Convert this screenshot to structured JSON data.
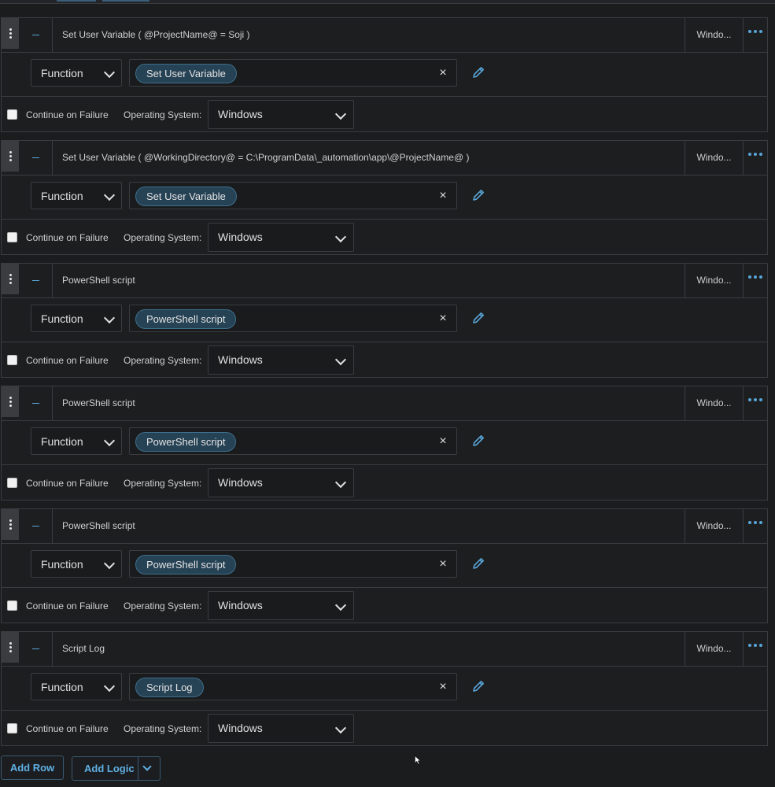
{
  "labels": {
    "function": "Function",
    "continue_on_failure": "Continue on Failure",
    "operating_system": "Operating System:",
    "clear_glyph": "×"
  },
  "steps": [
    {
      "title": "Set User Variable ( @ProjectName@ = Soji )",
      "os_short": "Windo...",
      "function_chip": "Set User Variable",
      "os_value": "Windows"
    },
    {
      "title": "Set User Variable ( @WorkingDirectory@ = C:\\ProgramData\\_automation\\app\\@ProjectName@ )",
      "os_short": "Windo...",
      "function_chip": "Set User Variable",
      "os_value": "Windows"
    },
    {
      "title": "PowerShell script",
      "os_short": "Windo...",
      "function_chip": "PowerShell script",
      "os_value": "Windows"
    },
    {
      "title": "PowerShell script",
      "os_short": "Windo...",
      "function_chip": "PowerShell script",
      "os_value": "Windows"
    },
    {
      "title": "PowerShell script",
      "os_short": "Windo...",
      "function_chip": "PowerShell script",
      "os_value": "Windows"
    },
    {
      "title": "Script Log",
      "os_short": "Windo...",
      "function_chip": "Script Log",
      "os_value": "Windows"
    }
  ],
  "footer": {
    "add_row": "Add Row",
    "add_logic": "Add Logic"
  },
  "colors": {
    "accent": "#58a6d8",
    "chip_bg": "#264255",
    "background": "#1b1c1e",
    "border": "#3a3c40"
  },
  "icons": {
    "drag": "vertical-dots-icon",
    "collapse": "minus-icon",
    "more": "horizontal-dots-icon",
    "clear": "close-icon",
    "edit": "pencil-icon",
    "dropdown": "chevron-down-icon"
  }
}
